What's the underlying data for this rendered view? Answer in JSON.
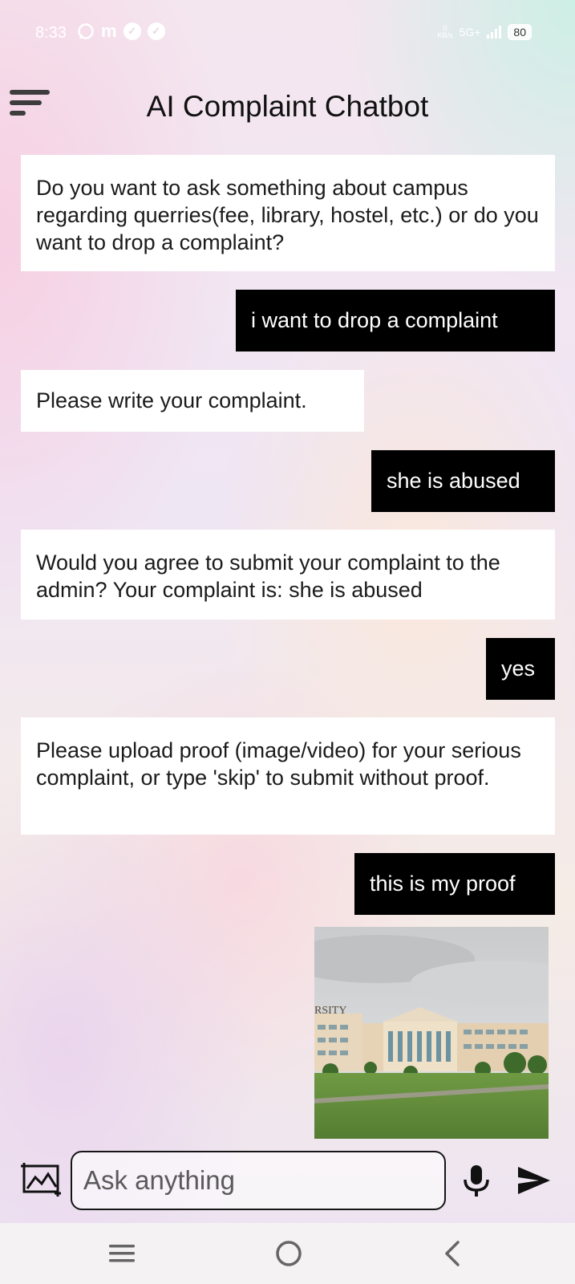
{
  "status_bar": {
    "time": "8:33",
    "app_m": "m",
    "net_rate_value": "0",
    "net_rate_unit": "KB/s",
    "network": "5G+",
    "battery": "80"
  },
  "header": {
    "title": "AI Complaint Chatbot"
  },
  "messages": [
    {
      "role": "bot",
      "text": "Do you want to ask something about campus regarding querries(fee, library, hostel, etc.) or do you want to drop a complaint?"
    },
    {
      "role": "user",
      "text": "i want to drop a complaint"
    },
    {
      "role": "bot",
      "text": "Please write your complaint."
    },
    {
      "role": "user",
      "text": "she is abused"
    },
    {
      "role": "bot",
      "text": "Would you agree to submit your complaint to the admin? Your complaint is: she is abused"
    },
    {
      "role": "user",
      "text": "yes"
    },
    {
      "role": "bot",
      "text": "Please upload proof (image/video) for your serious complaint, or type 'skip' to submit without proof."
    },
    {
      "role": "user",
      "text": "this is my proof"
    }
  ],
  "proof_image": {
    "sign_text": "RSITY"
  },
  "composer": {
    "placeholder": "Ask anything"
  },
  "icons": {
    "menu": "menu-icon",
    "image_upload": "image-upload-icon",
    "mic": "mic-icon",
    "send": "send-icon",
    "nav_recents": "recents-icon",
    "nav_home": "home-icon",
    "nav_back": "back-icon"
  }
}
